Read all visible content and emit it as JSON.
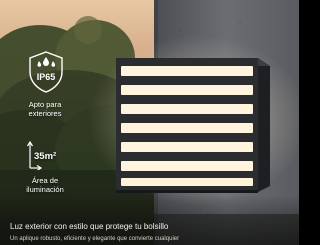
{
  "badges": {
    "waterproof": {
      "icon": "water-drops-icon",
      "rating": "IP65",
      "caption_lines": [
        "Apto para",
        "exteriores"
      ]
    },
    "coverage": {
      "icon": "area-arrows-icon",
      "value": "35m²",
      "caption_lines": [
        "Área de",
        "iluminación"
      ]
    }
  },
  "headline": "Luz exterior con estilo que protege tu bolsillo",
  "subline": "Un aplique robusto, eficiente y elegante que convierte cualquier",
  "colors": {
    "lamp_body": "#2a2c30",
    "lamp_glow": "#fff4dc",
    "wall": "#5f6166",
    "sky": "#e8c7a3",
    "foliage": "#3e4a2e"
  }
}
